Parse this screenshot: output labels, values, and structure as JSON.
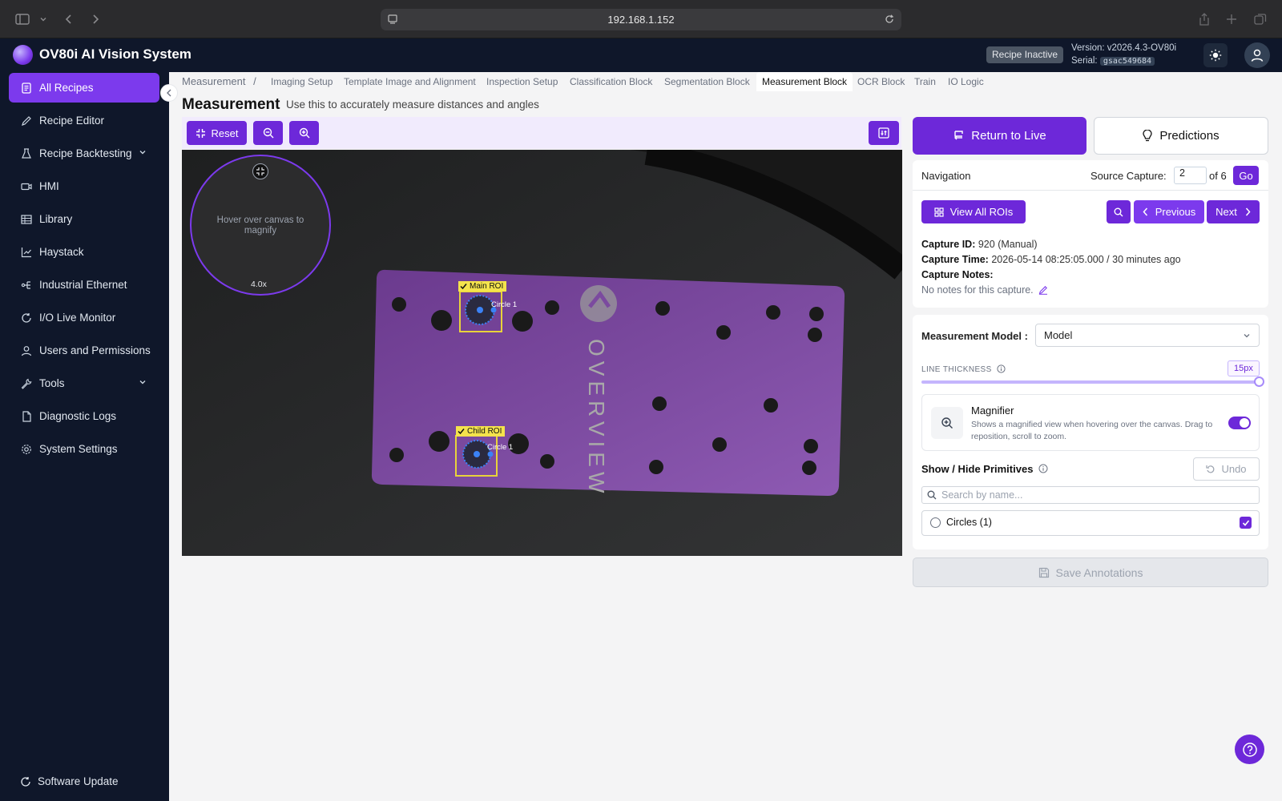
{
  "browser": {
    "url": "192.168.1.152"
  },
  "header": {
    "app_title": "OV80i AI Vision System",
    "recipe_status": "Recipe Inactive",
    "version_label": "Version: v2026.4.3-OV80i",
    "serial_label": "Serial:",
    "serial_value": "gsac549684"
  },
  "sidebar": {
    "items": [
      {
        "label": "All Recipes",
        "icon": "document-icon",
        "active": true
      },
      {
        "label": "Recipe Editor",
        "icon": "pencil-icon"
      },
      {
        "label": "Recipe Backtesting",
        "icon": "flask-icon",
        "expandable": true
      },
      {
        "label": "HMI",
        "icon": "video-icon"
      },
      {
        "label": "Library",
        "icon": "table-icon"
      },
      {
        "label": "Haystack",
        "icon": "bar-chart-icon"
      },
      {
        "label": "Industrial Ethernet",
        "icon": "network-icon"
      },
      {
        "label": "I/O Live Monitor",
        "icon": "refresh-icon"
      },
      {
        "label": "Users and Permissions",
        "icon": "user-icon"
      },
      {
        "label": "Tools",
        "icon": "wrench-icon",
        "expandable": true
      },
      {
        "label": "Diagnostic Logs",
        "icon": "file-icon"
      },
      {
        "label": "System Settings",
        "icon": "gear-icon"
      }
    ],
    "software_update": "Software Update"
  },
  "breadcrumb": {
    "root": "Measurement",
    "separator": "/"
  },
  "tabs": [
    {
      "label": "Imaging Setup"
    },
    {
      "label": "Template Image and Alignment"
    },
    {
      "label": "Inspection Setup"
    },
    {
      "label": "Classification Block"
    },
    {
      "label": "Segmentation Block"
    },
    {
      "label": "Measurement Block",
      "active": true
    },
    {
      "label": "OCR Block"
    },
    {
      "label": "Train"
    },
    {
      "label": "IO Logic"
    }
  ],
  "page": {
    "title": "Measurement",
    "subtitle": "Use this to accurately measure distances and angles"
  },
  "toolbar": {
    "reset_label": "Reset"
  },
  "canvas": {
    "magnifier_hint": "Hover over canvas to magnify",
    "magnifier_zoom": "4.0x",
    "part_text": "OVERVIEW",
    "rois": [
      {
        "label": "Main ROI",
        "circle_label": "Circle 1"
      },
      {
        "label": "Child ROI",
        "circle_label": "Circle 1"
      }
    ]
  },
  "actions": {
    "return_live": "Return to Live",
    "predictions": "Predictions"
  },
  "navigation": {
    "title": "Navigation",
    "source_capture_label": "Source Capture:",
    "source_capture_value": "2",
    "of_total": "of 6",
    "go_label": "Go",
    "view_all_rois": "View All ROIs",
    "previous": "Previous",
    "next": "Next"
  },
  "capture": {
    "id_label": "Capture ID:",
    "id_value": "920 (Manual)",
    "time_label": "Capture Time:",
    "time_value": "2026-05-14 08:25:05.000 / 30 minutes ago",
    "notes_label": "Capture Notes:",
    "notes_value": "No notes for this capture."
  },
  "settings": {
    "model_label": "Measurement Model :",
    "model_value": "Model",
    "line_thickness_label": "LINE THICKNESS",
    "line_thickness_value": "15px",
    "line_thickness_fraction": 1.0,
    "magnifier_title": "Magnifier",
    "magnifier_desc": "Shows a magnified view when hovering over the canvas. Drag to reposition, scroll to zoom.",
    "magnifier_enabled": true,
    "primitives_title": "Show / Hide Primitives",
    "undo_label": "Undo",
    "search_placeholder": "Search by name...",
    "primitives": [
      {
        "label": "Circles (1)",
        "checked": true
      }
    ],
    "save_label": "Save Annotations"
  },
  "colors": {
    "accent": "#6d28d9",
    "sidebar_bg": "#0f172a",
    "roi_yellow": "#f4e34c"
  }
}
